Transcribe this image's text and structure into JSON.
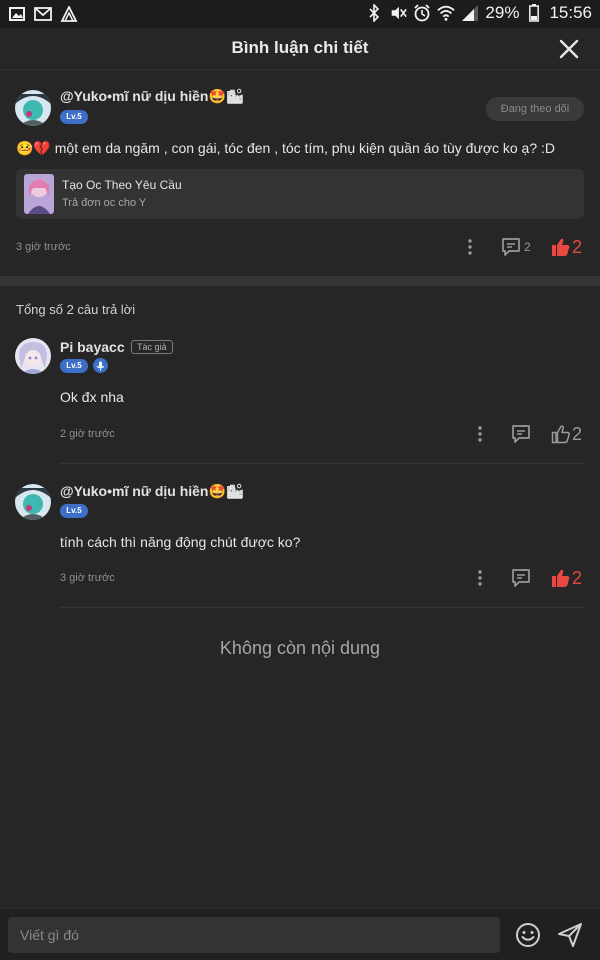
{
  "status_bar": {
    "battery": "29%",
    "time": "15:56"
  },
  "header": {
    "title": "Bình luận chi tiết"
  },
  "main_comment": {
    "username": "@Yuko•mĩ nữ dịu hiền🤩🏙",
    "level": "Lv.5",
    "follow_label": "Đang theo dõi",
    "text": "🤒💔 một em da ngăm , con gái, tóc đen , tóc tím, phụ kiện quần áo tùy được ko ạ? :D",
    "card": {
      "title": "Tạo Oc Theo Yêu Cầu",
      "subtitle": "Trả đơn oc cho Y"
    },
    "time": "3 giờ trước",
    "reply_count": "2",
    "like_count": "2"
  },
  "replies_header": "Tổng số 2 câu trả lời",
  "replies": [
    {
      "username": "Pi bayacc",
      "tag": "Tác giả",
      "level": "Lv.5",
      "text": "Ok đx nha",
      "time": "2 giờ trước",
      "like_count": "2",
      "liked": false
    },
    {
      "username": "@Yuko•mĩ nữ dịu hiền🤩🏙",
      "level": "Lv.5",
      "text": "tính cách thì năng động chút được ko?",
      "time": "3 giờ trước",
      "like_count": "2",
      "liked": true
    }
  ],
  "empty_text": "Không còn nội dung",
  "composer": {
    "placeholder": "Viết gì đó"
  },
  "colors": {
    "background": "#262626",
    "like_active": "#e8483f",
    "level_badge": "#3d6fc8",
    "muted_text": "#8f8f8f"
  }
}
